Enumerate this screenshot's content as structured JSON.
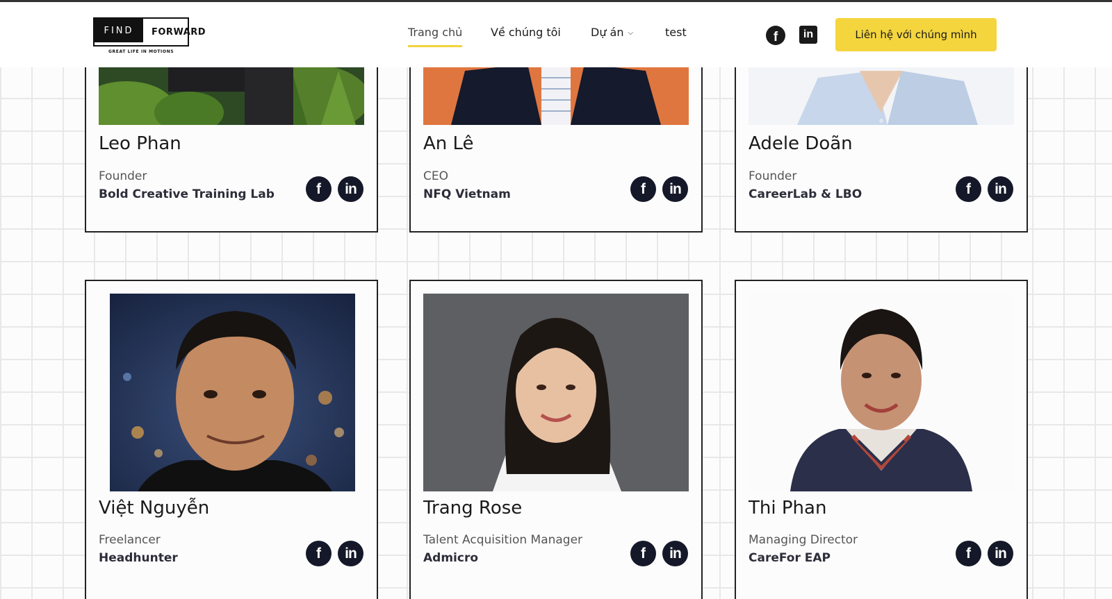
{
  "header": {
    "logo_find": "FIND",
    "logo_forward": "FORWARD",
    "logo_tagline": "GREAT LIFE IN MOTIONS",
    "nav": [
      {
        "label": "Trang chủ",
        "active": true
      },
      {
        "label": "Về chúng tôi"
      },
      {
        "label": "Dự án",
        "dropdown": true
      },
      {
        "label": "test"
      }
    ],
    "social": {
      "facebook_glyph": "f",
      "linkedin_glyph": "in"
    },
    "cta_label": "Liên hệ với chúng mình",
    "accent_color": "#f4d53e"
  },
  "people": [
    {
      "name": "Leo Phan",
      "role": "Founder",
      "company": "Bold Creative Training Lab"
    },
    {
      "name": "An Lê",
      "role": "CEO",
      "company": "NFQ Vietnam"
    },
    {
      "name": "Adele Doãn",
      "role": "Founder",
      "company": "CareerLab & LBO"
    },
    {
      "name": "Việt Nguyễn",
      "role": "Freelancer",
      "company": "Headhunter"
    },
    {
      "name": "Trang Rose",
      "role": "Talent Acquisition Manager",
      "company": "Admicro"
    },
    {
      "name": "Thi Phan",
      "role": "Managing Director",
      "company": "CareFor EAP"
    }
  ],
  "card_social": {
    "facebook": "f",
    "linkedin": "in"
  }
}
